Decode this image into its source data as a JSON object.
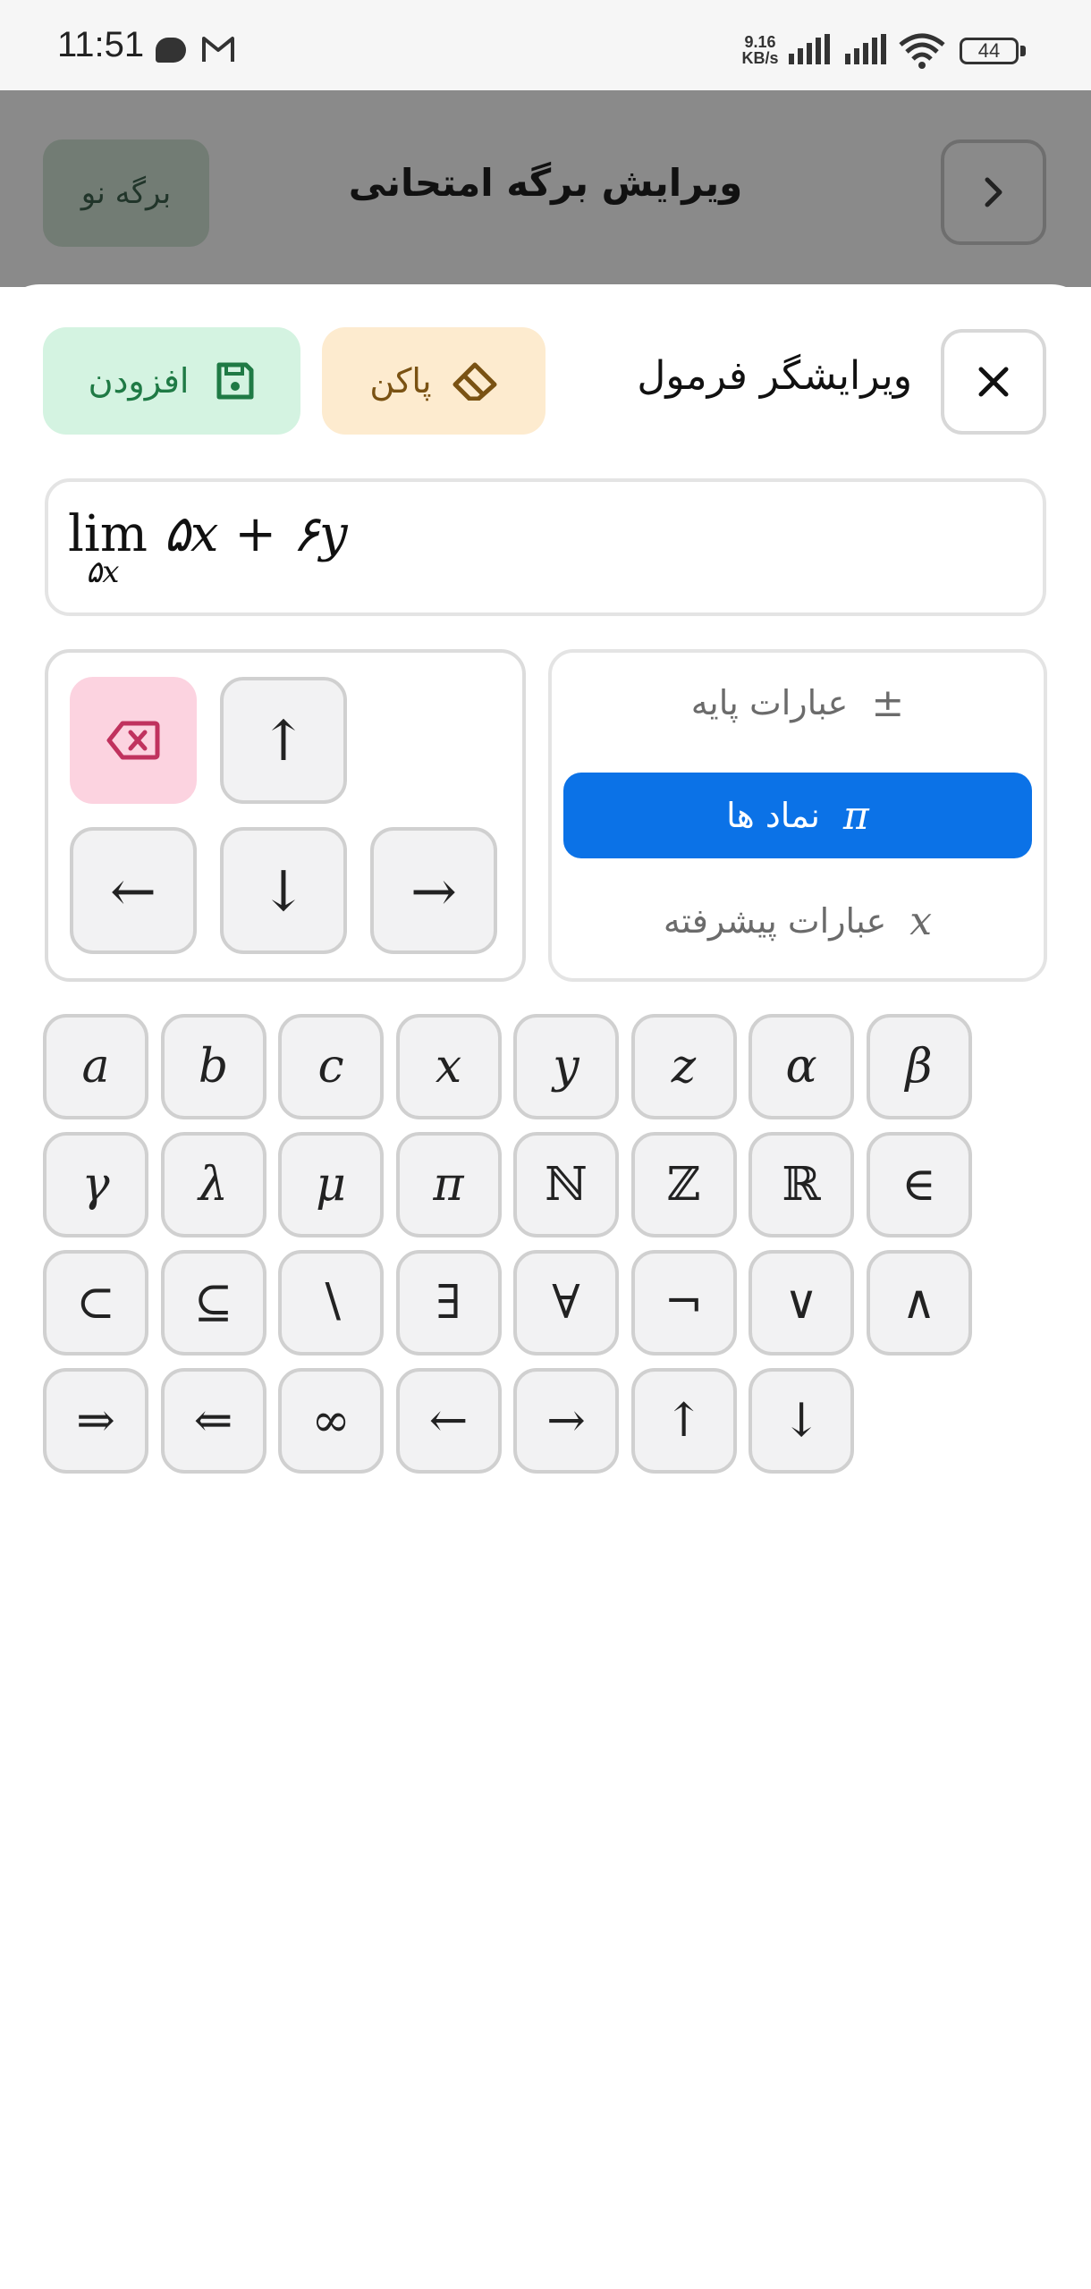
{
  "status_bar": {
    "time": "11:51",
    "net_speed_value": "9.16",
    "net_speed_unit": "KB/s",
    "battery": "44"
  },
  "background_header": {
    "title": "ویرایش برگه امتحانی",
    "new_sheet_label": "برگه نو"
  },
  "formula_editor": {
    "title": "ویرایشگر فرمول",
    "clear_label": "پاکن",
    "add_label": "افزودن",
    "formula": {
      "lim": "lim",
      "body": "۵x + ۶y",
      "subscript": "۵x"
    }
  },
  "navigation_keys": {
    "up": "↑",
    "left": "←",
    "down": "↓",
    "right": "→"
  },
  "categories": [
    {
      "icon": "±",
      "label": "عبارات پایه",
      "active": false
    },
    {
      "icon": "π",
      "label": "نماد ها",
      "active": true
    },
    {
      "icon": "x",
      "label": "عبارات پیشرفته",
      "active": false
    }
  ],
  "symbols": [
    [
      "a",
      "b",
      "c",
      "x",
      "y",
      "z",
      "α",
      "β"
    ],
    [
      "γ",
      "λ",
      "μ",
      "π",
      "ℕ",
      "ℤ",
      "ℝ",
      "∈"
    ],
    [
      "⊂",
      "⊆",
      "∖",
      "∃",
      "∀",
      "¬",
      "∨",
      "∧"
    ],
    [
      "⇒",
      "⇐",
      "∞",
      "←",
      "→",
      "↑",
      "↓"
    ]
  ],
  "colors": {
    "active_tab": "#0b72e7",
    "add_bg": "#d4f3e1",
    "clear_bg": "#fdebcf",
    "delete_bg": "#fcd3e0"
  }
}
